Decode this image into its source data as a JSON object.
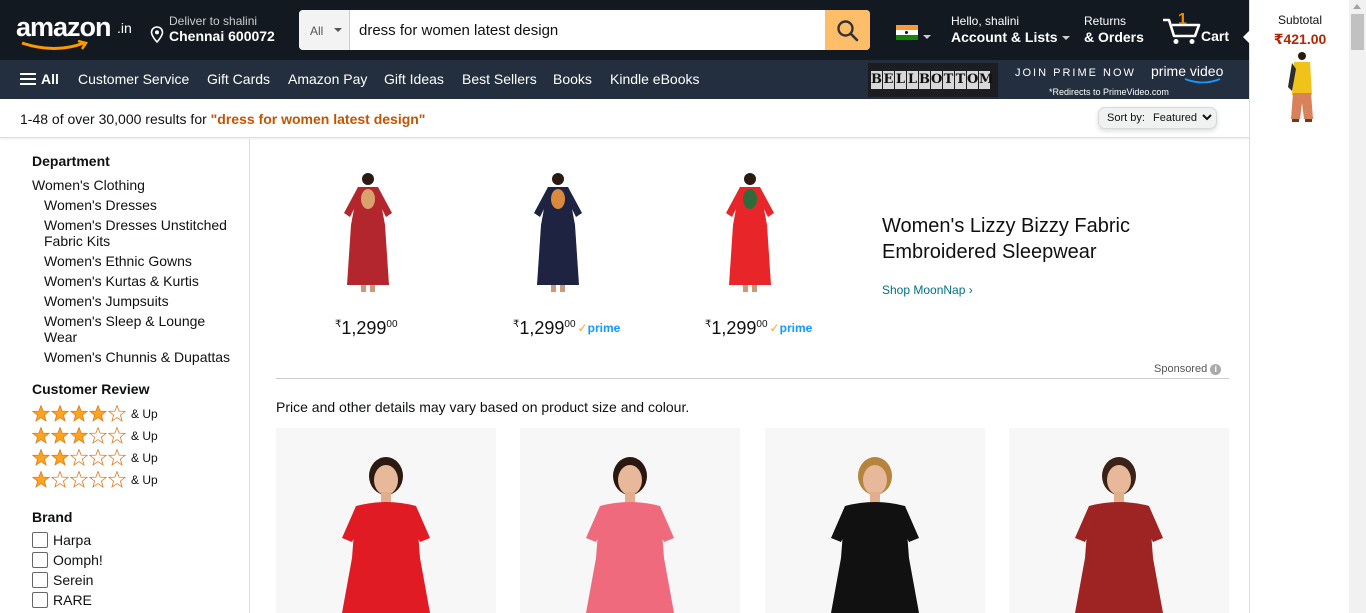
{
  "header": {
    "logo": {
      "word": "amazon",
      "suffix": ".in"
    },
    "deliver": {
      "line1": "Deliver to shalini",
      "line2": "Chennai 600072"
    },
    "search": {
      "category": "All",
      "query": "dress for women latest design"
    },
    "account": {
      "line1": "Hello, shalini",
      "line2": "Account & Lists"
    },
    "orders": {
      "line1": "Returns",
      "line2": "& Orders"
    },
    "cart": {
      "count": "1",
      "label": "Cart"
    }
  },
  "nav": {
    "all": "All",
    "items": [
      "Customer Service",
      "Gift Cards",
      "Amazon Pay",
      "Gift Ideas",
      "Best Sellers",
      "Books",
      "Kindle eBooks"
    ],
    "promo": {
      "bellbottom": [
        "B",
        "E",
        "L",
        "L",
        "B",
        "O",
        "T",
        "T",
        "O",
        "M"
      ],
      "join": "JOIN PRIME NOW",
      "prime_video": "prime video",
      "redirect": "*Redirects to PrimeVideo.com"
    }
  },
  "results": {
    "prefix": "1-48 of over 30,000 results for ",
    "query": "\"dress for women latest design\"",
    "sort_label": "Sort by:",
    "sort_value": "Featured"
  },
  "sidebar": {
    "department_heading": "Department",
    "department_root": "Women's Clothing",
    "departments": [
      "Women's Dresses",
      "Women's Dresses Unstitched Fabric Kits",
      "Women's Ethnic Gowns",
      "Women's Kurtas & Kurtis",
      "Women's Jumpsuits",
      "Women's Sleep & Lounge Wear",
      "Women's Chunnis & Dupattas"
    ],
    "review_heading": "Customer Review",
    "review_suffix": "& Up",
    "review_ratings": [
      4,
      3,
      2,
      1
    ],
    "brand_heading": "Brand",
    "brands": [
      "Harpa",
      "Oomph!",
      "Serein",
      "RARE"
    ]
  },
  "sponsored": {
    "products": [
      {
        "symbol": "₹",
        "whole": "1,299",
        "fraction": "00",
        "prime": false,
        "dress_color": "#b3262e",
        "accent": "#d9a26a"
      },
      {
        "symbol": "₹",
        "whole": "1,299",
        "fraction": "00",
        "prime": true,
        "dress_color": "#1d2340",
        "accent": "#d98a3c"
      },
      {
        "symbol": "₹",
        "whole": "1,299",
        "fraction": "00",
        "prime": true,
        "dress_color": "#e8262a",
        "accent": "#2f6b3a"
      }
    ],
    "prime_label": "prime",
    "brand_title": "Women's Lizzy Bizzy Fabric Embroidered Sleepwear",
    "shop_link": "Shop MoonNap ›",
    "sponsored_label": "Sponsored",
    "info_glyph": "i"
  },
  "note": "Price and other details may vary based on product size and colour.",
  "grid": [
    {
      "dress_color": "#e01b24",
      "hair": "#2b1a12"
    },
    {
      "dress_color": "#ef6a7d",
      "hair": "#2a1710"
    },
    {
      "dress_color": "#111111",
      "hair": "#b5843d"
    },
    {
      "dress_color": "#9e2323",
      "hair": "#3a2216"
    }
  ],
  "subtotal": {
    "label": "Subtotal",
    "amount": "₹421.00"
  },
  "colors": {
    "nav_dark": "#131921",
    "nav_light": "#232f3e",
    "search_btn": "#febd69",
    "link": "#007185",
    "query": "#c45500",
    "price_red": "#b12704",
    "star": "#ffa41c"
  }
}
